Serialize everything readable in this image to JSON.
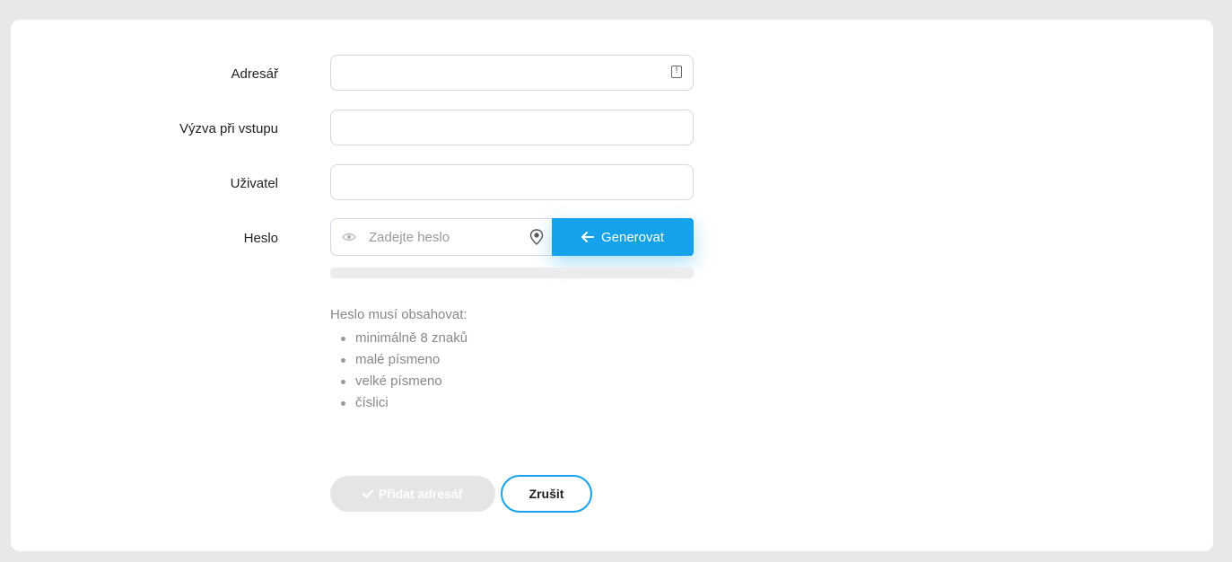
{
  "form": {
    "directory_label": "Adresář",
    "directory_value": "",
    "prompt_label": "Výzva při vstupu",
    "prompt_value": "",
    "user_label": "Uživatel",
    "user_value": "",
    "password_label": "Heslo",
    "password_placeholder": "Zadejte heslo",
    "generate_label": "Generovat"
  },
  "hints": {
    "title": "Heslo musí obsahovat:",
    "items": [
      "minimálně 8 znaků",
      "malé písmeno",
      "velké písmeno",
      "číslici"
    ]
  },
  "actions": {
    "add_label": "Přidat adresář",
    "cancel_label": "Zrušit"
  },
  "colors": {
    "accent": "#14a2ea",
    "disabled": "#e5e5e5",
    "background": "#e8e8e8"
  },
  "icons": {
    "directory_field": "contact-card-icon",
    "password_visibility": "eye-icon",
    "password_extra": "pin-icon",
    "generate": "arrow-left-icon",
    "add": "check-icon"
  }
}
